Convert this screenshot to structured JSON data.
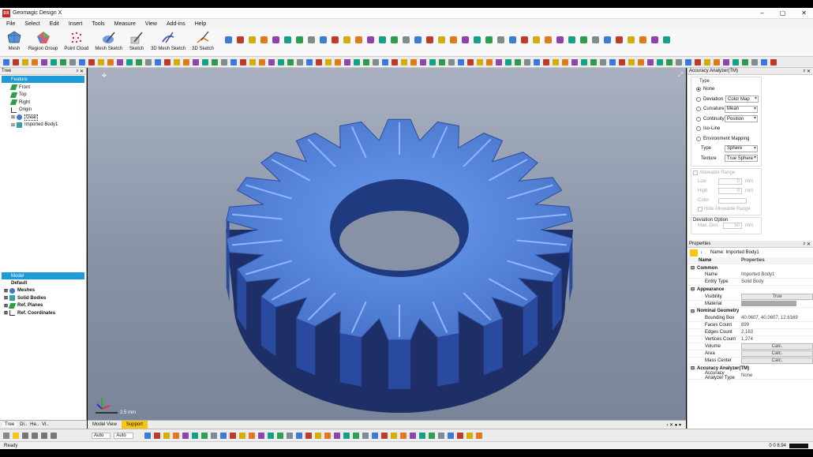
{
  "app": {
    "title": "Geomagic Design X",
    "logo": "DX"
  },
  "menu": [
    "File",
    "Select",
    "Edit",
    "Insert",
    "Tools",
    "Measure",
    "View",
    "Add-ins",
    "Help"
  ],
  "ribbon": [
    {
      "label": "Mesh",
      "icon": "mesh-icon"
    },
    {
      "label": "Region Group",
      "icon": "region-group-icon"
    },
    {
      "label": "Point Cloud",
      "icon": "point-cloud-icon"
    },
    {
      "label": "Mesh Sketch",
      "icon": "mesh-sketch-icon"
    },
    {
      "label": "Sketch",
      "icon": "sketch-icon"
    },
    {
      "label": "3D Mesh Sketch",
      "icon": "3d-mesh-sketch-icon"
    },
    {
      "label": "3D Sketch",
      "icon": "3d-sketch-icon"
    }
  ],
  "tree": {
    "header": "Tree",
    "feature_label": "Feature",
    "items": [
      "Front",
      "Top",
      "Right",
      "Origin",
      "Gear",
      "Imported Body1"
    ]
  },
  "model": {
    "header": "Model",
    "default_label": "Default",
    "items": [
      "Meshes",
      "Solid Bodies",
      "Ref. Planes",
      "Ref. Coordinates"
    ]
  },
  "left_tabs": [
    "Tree",
    "Di..",
    "He..",
    "Vi.."
  ],
  "view_tabs": [
    "Model View",
    "Support"
  ],
  "scale_label": "2.5 mm",
  "accuracy": {
    "title": "Accuracy Analyzer(TM)",
    "type_label": "Type",
    "options": [
      {
        "label": "None",
        "selected": true,
        "value": ""
      },
      {
        "label": "Deviation",
        "selected": false,
        "value": "Color Map"
      },
      {
        "label": "Curvature",
        "selected": false,
        "value": "Mean"
      },
      {
        "label": "Continuity",
        "selected": false,
        "value": "Position"
      },
      {
        "label": "Iso-Line",
        "selected": false,
        "value": ""
      },
      {
        "label": "Environment Mapping",
        "selected": false,
        "value": ""
      }
    ],
    "env_type_label": "Type",
    "env_type_value": "Sphere",
    "texture_label": "Texture",
    "texture_value": "True Sphere",
    "allowable_range": "Allowable Range",
    "low_label": "Low",
    "low_value": "0",
    "high_label": "High",
    "high_value": "0",
    "unit": "mm",
    "color_label": "Color",
    "hide_allowable": "Hide Allowable Range",
    "deviation_option": "Deviation Option",
    "max_dist_label": "Max. Dist.",
    "max_dist_value": "50"
  },
  "properties": {
    "title": "Properties",
    "name_line": "Name: Imported Body1",
    "col_name": "Name",
    "col_props": "Properties",
    "sections": {
      "common": "Common",
      "appearance": "Appearance",
      "nominal": "Nominal Geometry",
      "accuracy": "Accuracy Analyzer(TM)"
    },
    "rows": {
      "name": [
        "Name",
        "Imported Body1"
      ],
      "entity": [
        "Entity Type",
        "Solid Body"
      ],
      "visibility": [
        "Visibility",
        "True"
      ],
      "material": [
        "Material",
        ""
      ],
      "bbox": [
        "Bounding Box",
        "40.0607, 40.0607, 12.6169"
      ],
      "faces": [
        "Faces Count",
        "899"
      ],
      "edges": [
        "Edges Count",
        "2,163"
      ],
      "vertices": [
        "Vertices Count",
        "1,274"
      ],
      "volume": [
        "Volume",
        "Calc."
      ],
      "area": [
        "Area",
        "Calc."
      ],
      "mass": [
        "Mass Center",
        "Calc."
      ],
      "analyzer_type": [
        "Accuracy Analyzer Type",
        "None"
      ]
    }
  },
  "bottom": {
    "combo1": "Auto",
    "combo2": "Auto"
  },
  "status": {
    "text": "Ready",
    "value": "0 0 8.94"
  },
  "colors": {
    "accent": "#1e9ad6",
    "gear": "#4f7fd8",
    "viewport": "#8792a6"
  }
}
